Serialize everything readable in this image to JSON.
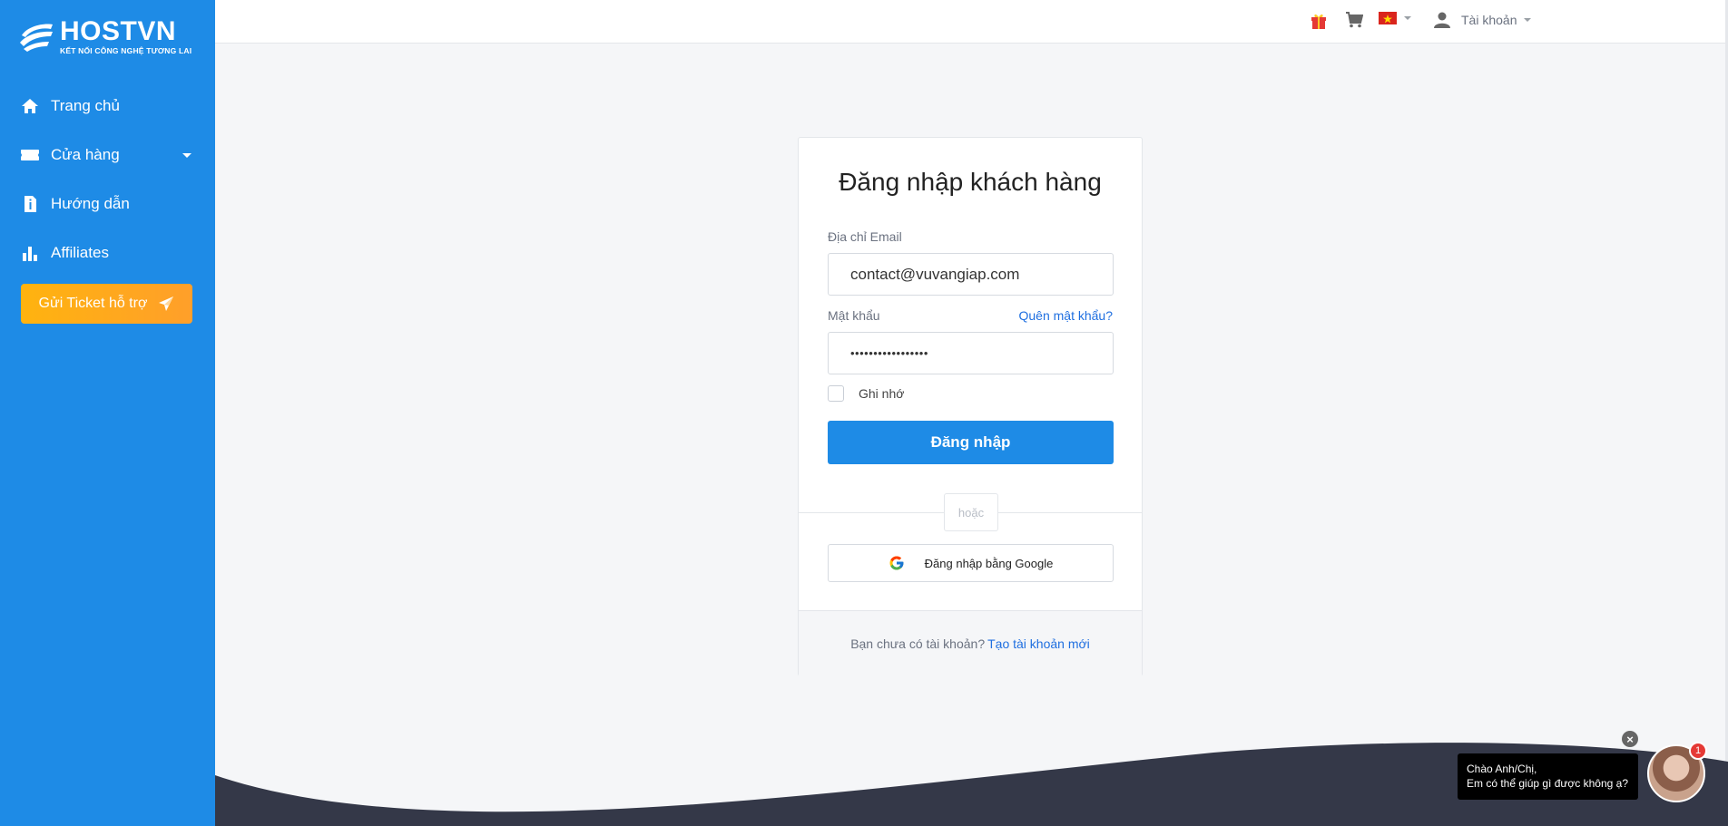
{
  "brand": {
    "name": "HOSTVN",
    "tagline": "KẾT NỐI CÔNG NGHỆ TƯƠNG LAI"
  },
  "sidebar": {
    "items": [
      {
        "label": "Trang chủ",
        "icon": "home-icon"
      },
      {
        "label": "Cửa hàng",
        "icon": "ticket-icon"
      },
      {
        "label": "Hướng dẫn",
        "icon": "document-info-icon"
      },
      {
        "label": "Affiliates",
        "icon": "bar-chart-icon"
      }
    ],
    "ticket_button": "Gửi Ticket hỗ trợ"
  },
  "topbar": {
    "account_label": "Tài khoản"
  },
  "login": {
    "title": "Đăng nhập khách hàng",
    "email_label": "Địa chỉ Email",
    "email_value": "contact@vuvangiap.com",
    "password_label": "Mật khẩu",
    "password_value": "•••••••••••••••••",
    "forgot_link": "Quên mật khẩu?",
    "remember_label": "Ghi nhớ",
    "submit": "Đăng nhập",
    "or": "hoặc",
    "google_button": "Đăng nhập bằng Google",
    "no_account": "Bạn chưa có tài khoản?",
    "create_link": "Tạo tài khoản mới"
  },
  "chat": {
    "line1": "Chào Anh/Chị,",
    "line2": "Em có thể giúp gì được không ạ?",
    "badge": "1"
  },
  "colors": {
    "sidebar": "#1e8be6",
    "primary_button": "#1e8be6",
    "ticket_button": "#ffa51f",
    "link": "#1f6fe0",
    "wave": "#343848"
  }
}
